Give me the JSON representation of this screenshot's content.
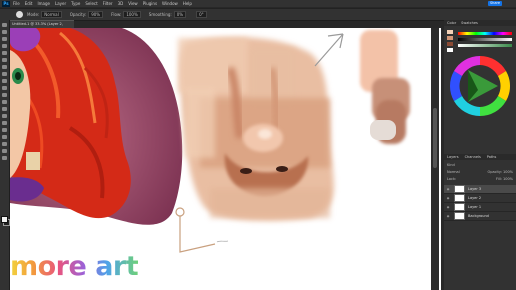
{
  "menubar": {
    "app_logo": "Ps",
    "items": [
      "File",
      "Edit",
      "Image",
      "Layer",
      "Type",
      "Select",
      "Filter",
      "3D",
      "View",
      "Plugins",
      "Window",
      "Help"
    ],
    "share_label": "Share"
  },
  "options_bar": {
    "mode_label": "Mode:",
    "mode_value": "Normal",
    "opacity_label": "Opacity:",
    "opacity_value": "90%",
    "flow_label": "Flow:",
    "flow_value": "100%",
    "smoothing_label": "Smoothing:",
    "smoothing_value": "0%",
    "angle_value": "0°"
  },
  "document_tab": {
    "title": "Untitled-1 @ 33.3% (Layer 2, RGB/8) *"
  },
  "panels": {
    "top_tabs": [
      "Color",
      "Swatches"
    ],
    "wheel_icon": "color-wheel-icon",
    "layers_tabs": [
      "Layers",
      "Channels",
      "Paths"
    ],
    "kind_label": "Kind",
    "blend_mode": "Normal",
    "opacity_label": "Opacity:",
    "opacity_value": "100%",
    "lock_label": "Lock:",
    "fill_label": "Fill:",
    "fill_value": "100%",
    "layers": [
      {
        "name": "Layer 3",
        "active": true
      },
      {
        "name": "Layer 2",
        "active": false
      },
      {
        "name": "Layer 1",
        "active": false
      },
      {
        "name": "Background",
        "active": false
      }
    ]
  },
  "watermark": {
    "text": "more art"
  },
  "colors": {
    "panel_bg": "#323232",
    "accent": "#1473e6",
    "hair": "#e8321e",
    "skin": "#d9a07f"
  }
}
